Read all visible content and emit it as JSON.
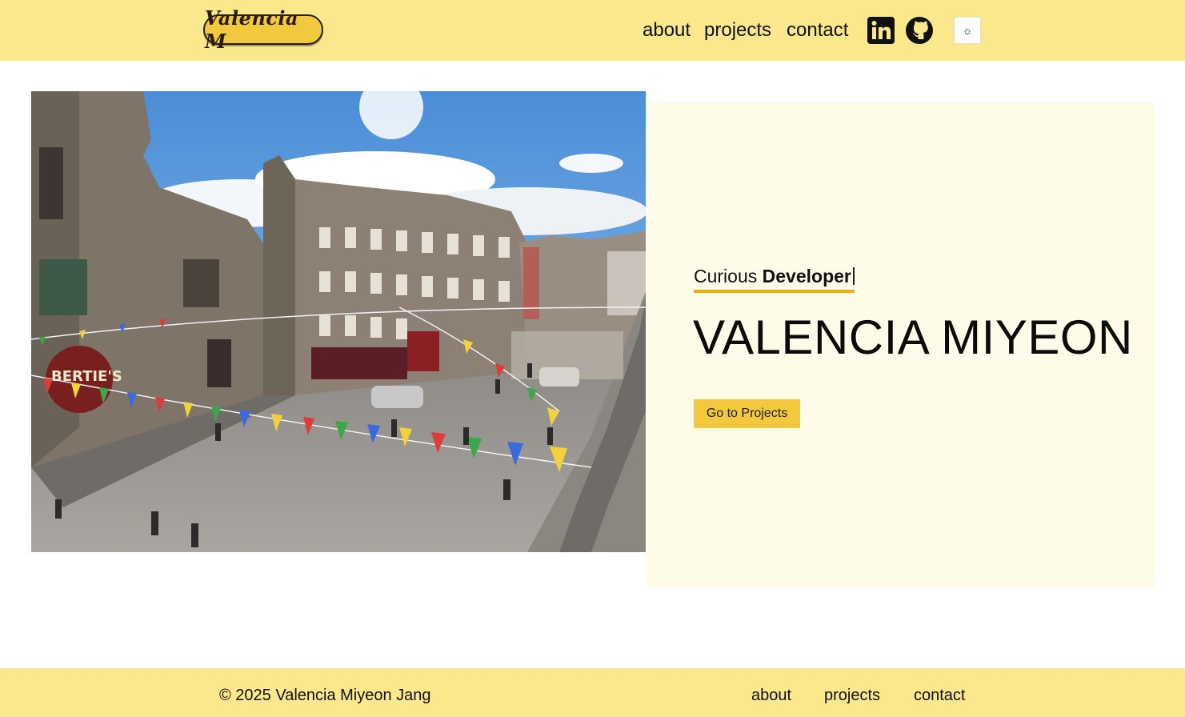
{
  "header": {
    "logo_text": "Valencia M",
    "nav": {
      "about": "about",
      "projects": "projects",
      "contact": "contact"
    },
    "icons": {
      "linkedin": "linkedin-icon",
      "github": "github-icon",
      "theme": "sun-icon"
    },
    "theme_toggle_glyph": "☼"
  },
  "hero": {
    "image_alt": "Edinburgh street with colorful bunting",
    "tagline_prefix": "Curious",
    "tagline_role": "Developer",
    "name": "VALENCIA MIYEON",
    "cta_label": "Go to Projects"
  },
  "footer": {
    "copyright": "© 2025 Valencia Miyeon Jang",
    "links": {
      "about": "about",
      "projects": "projects",
      "contact": "contact"
    }
  },
  "colors": {
    "header_bg": "#fbe78c",
    "accent": "#f2c93c",
    "panel_bg": "#fefbe8",
    "underline": "#eab308"
  }
}
